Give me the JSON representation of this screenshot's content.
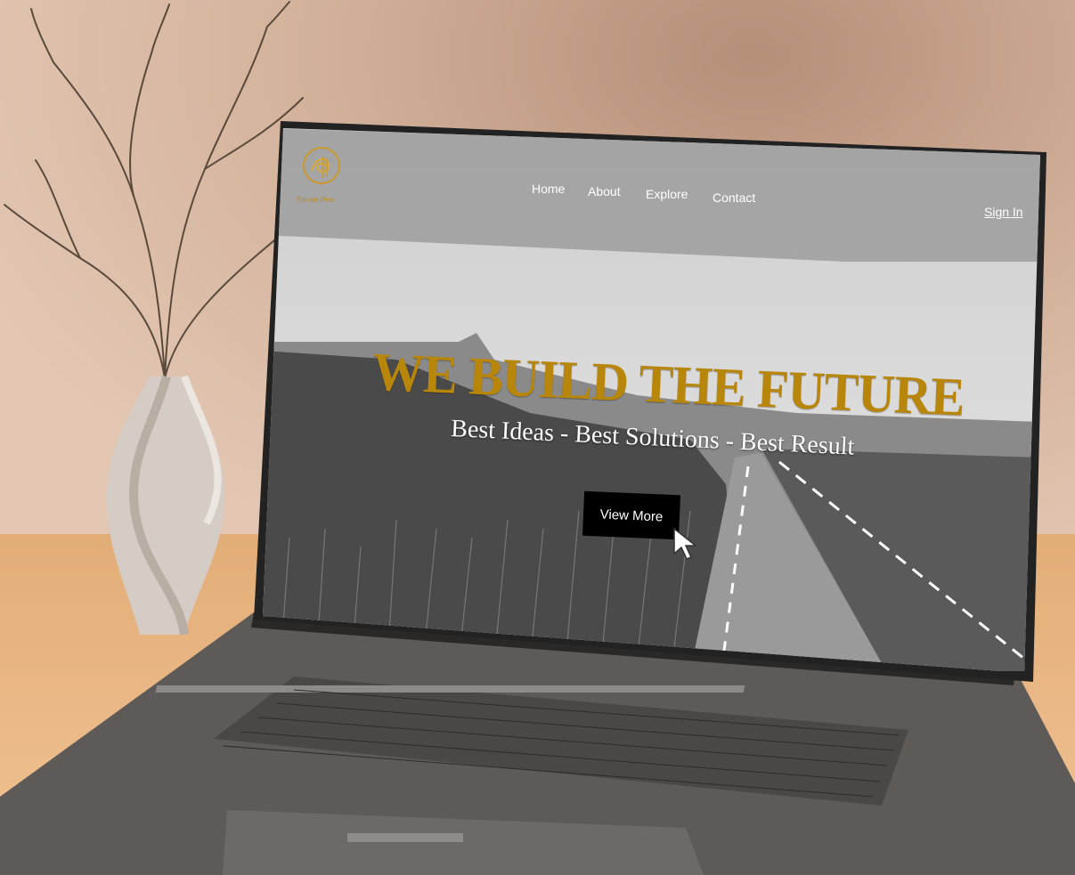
{
  "brand": {
    "logo_text": "Steven Pnw",
    "accent": "#b8860b"
  },
  "nav": {
    "links": [
      {
        "label": "Home"
      },
      {
        "label": "About"
      },
      {
        "label": "Explore"
      },
      {
        "label": "Contact"
      }
    ],
    "sign_in": "Sign In"
  },
  "hero": {
    "title": "WE BUILD THE FUTURE",
    "subtitle": "Best Ideas - Best Solutions - Best Result",
    "cta_label": "View More"
  },
  "icons": {
    "logo": "brand-logo-icon",
    "cursor": "mouse-cursor-icon"
  }
}
